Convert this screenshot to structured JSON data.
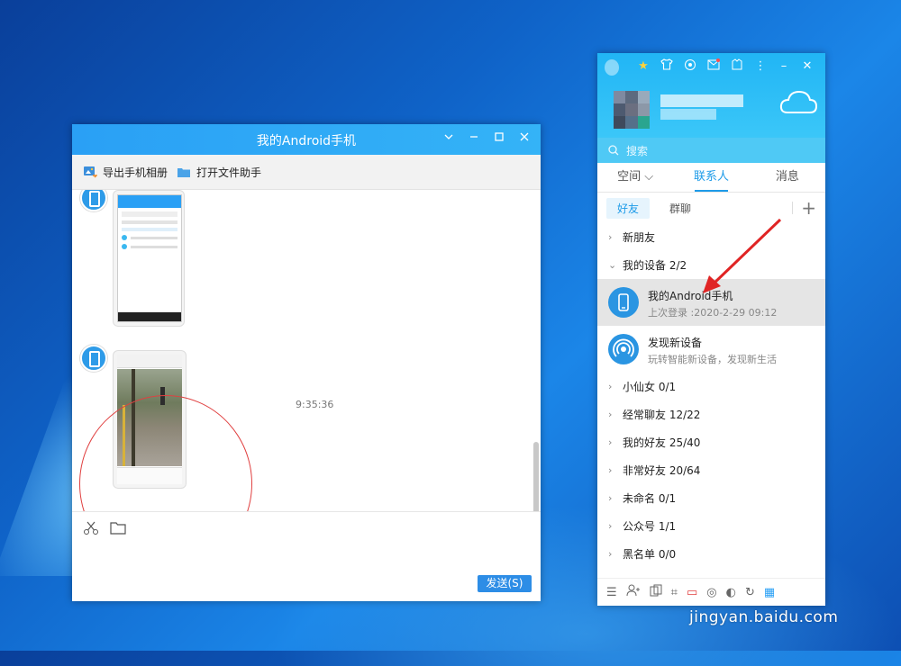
{
  "chat_window": {
    "title": "我的Android手机",
    "toolbar": {
      "export_album": "导出手机相册",
      "open_file_assistant": "打开文件助手"
    },
    "timestamp": "9:35:36",
    "send_label": "发送(S)"
  },
  "qq_panel": {
    "search_placeholder": "搜索",
    "tabs": [
      "空间 ⌵",
      "联系人",
      "消息"
    ],
    "active_tab": "联系人",
    "subtabs": [
      "好友",
      "群聊"
    ],
    "groups_top": [
      {
        "label": "新朋友",
        "expanded": false
      },
      {
        "label": "我的设备 2/2",
        "expanded": true
      }
    ],
    "devices": [
      {
        "name": "我的Android手机",
        "sub": "上次登录 :2020-2-29 09:12",
        "selected": true
      },
      {
        "name": "发现新设备",
        "sub": "玩转智能新设备，发现新生活",
        "selected": false
      }
    ],
    "groups": [
      "小仙女 0/1",
      "经常聊友 12/22",
      "我的好友 25/40",
      "非常好友 20/64",
      "未命名 0/1",
      "公众号 1/1",
      "黑名单 0/0"
    ]
  },
  "watermark": "jingyan.baidu.com",
  "colors": {
    "accent": "#1e9be8",
    "title_bar": "#2aa0f5",
    "selected_row": "#e5e5e5",
    "annotation": "#e04040"
  }
}
